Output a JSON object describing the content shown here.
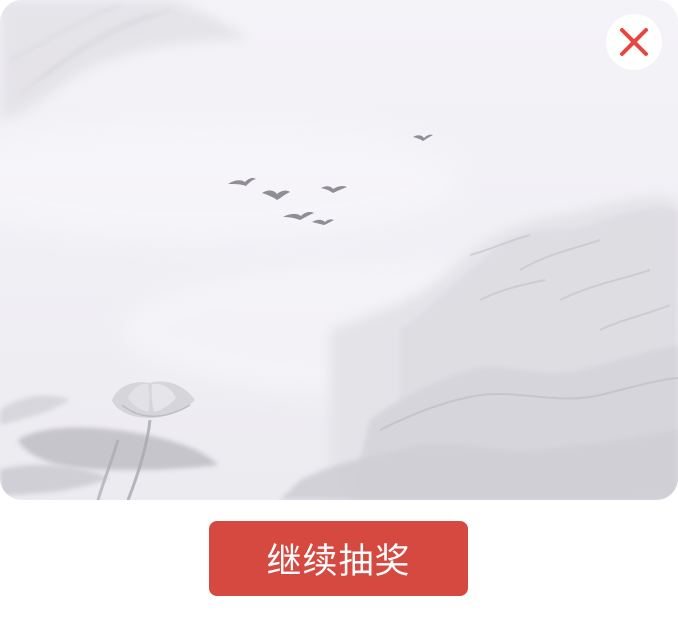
{
  "dialog": {
    "action_label": "继续抽奖",
    "close_icon": "close-icon"
  },
  "colors": {
    "accent": "#d64940",
    "close_icon": "#e8463f",
    "background": "#f2f1f6"
  },
  "icons": {
    "close": "close-icon",
    "illustration": "ink-landscape-illustration"
  }
}
